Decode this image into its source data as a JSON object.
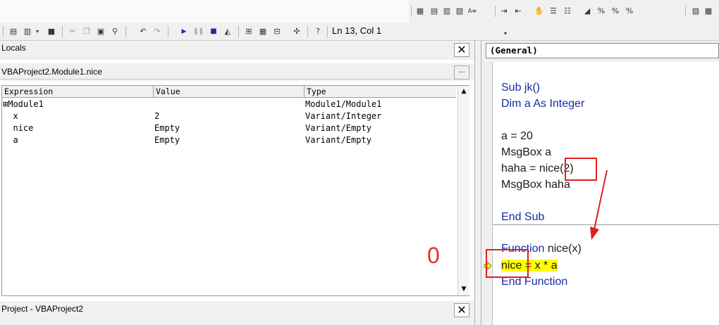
{
  "toolbar": {
    "position_text": "Ln 13, Col 1"
  },
  "locals": {
    "title": "Locals",
    "close_label": "✕",
    "context": "VBAProject2.Module1.nice",
    "context_button": "...",
    "columns": [
      "Expression",
      "Value",
      "Type"
    ],
    "rows": [
      {
        "expression": "⊞Module1",
        "value": "",
        "type": "Module1/Module1"
      },
      {
        "expression": "  x",
        "value": "2",
        "type": "Variant/Integer"
      },
      {
        "expression": "  nice",
        "value": "Empty",
        "type": "Variant/Empty"
      },
      {
        "expression": "  a",
        "value": "Empty",
        "type": "Variant/Empty"
      }
    ]
  },
  "project": {
    "title": "Project - VBAProject2",
    "close_label": "✕"
  },
  "code": {
    "object_dropdown": "(General)",
    "line1_kw": "Sub jk()",
    "line2_kw": "Dim a As Integer",
    "line3": "a = 20",
    "line4": "MsgBox a",
    "line5a": "haha = nice",
    "line5b": "(2)",
    "line6": "MsgBox haha",
    "line7_kw": "End Sub",
    "line8a": "Function",
    "line8b": " nice(x)",
    "line9a": "nice",
    "line9b": "= x * a",
    "line10_kw": "End Function"
  },
  "annotation": {
    "zero_label": "0"
  },
  "colors": {
    "keyword": "#1a2aa0",
    "highlight": "#ffff00",
    "annotation_red": "#e02020"
  }
}
